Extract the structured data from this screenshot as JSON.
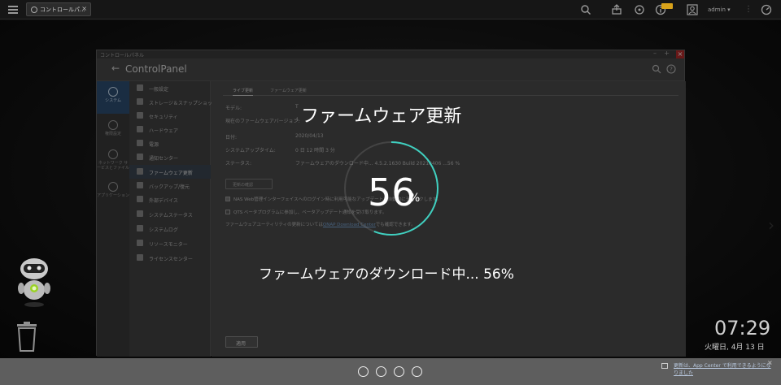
{
  "taskbar": {
    "tab_label": "コントロールパ...",
    "close_glyph": "×",
    "user": "admin ▾"
  },
  "window": {
    "titlebar_title": "コントロールパネル",
    "ctrl_minimize": "–",
    "ctrl_maximize": "+",
    "ctrl_close": "×",
    "app_title": "ControlPanel",
    "back_glyph": "←"
  },
  "categories": [
    {
      "label": "システム"
    },
    {
      "label": "権限設定"
    },
    {
      "label": "ネットワーク サービスとファイル"
    },
    {
      "label": "アプリケーション"
    }
  ],
  "nav": [
    {
      "label": "一般設定"
    },
    {
      "label": "ストレージ＆スナップショット"
    },
    {
      "label": "セキュリティ"
    },
    {
      "label": "ハードウェア"
    },
    {
      "label": "電源"
    },
    {
      "label": "通知センター"
    },
    {
      "label": "ファームウェア更新"
    },
    {
      "label": "バックアップ/復元"
    },
    {
      "label": "外部デバイス"
    },
    {
      "label": "システムステータス"
    },
    {
      "label": "システムログ"
    },
    {
      "label": "リソースモニター"
    },
    {
      "label": "ライセンスセンター"
    }
  ],
  "content": {
    "tabs": [
      "ライブ更新",
      "ファームウェア更新"
    ],
    "rows": [
      {
        "label": "モデル:",
        "value": "T"
      },
      {
        "label": "現在のファームウェアバージョン:",
        "value": "4."
      },
      {
        "label": "日付:",
        "value": "2020/04/13"
      },
      {
        "label": "システムアップタイム:",
        "value": "0 日 12 時間 3 分"
      },
      {
        "label": "ステータス:",
        "value": "ファームウェアのダウンロード中... 4.5.2.1630 Build 20210406 ...56 %"
      }
    ],
    "check_button": "更新の確認",
    "checkbox_1": "NAS Web管理インターフェイスへのログイン時に利用可能なアップデートを自動的にチェックします。",
    "checkbox_2": "QTS ベータプログラムに参加し、ベータアップデート通知を受け取ります。",
    "note_prefix": "ファームウェアユーティリティの更新については",
    "note_link": "QNAP Download Center",
    "note_suffix": "でも確認できます。",
    "apply": "適用"
  },
  "overlay": {
    "title": "ファームウェア更新",
    "percent": "56",
    "percent_unit": "%",
    "status": "ファームウェアのダウンロード中... 56%",
    "progress": 0.56
  },
  "clock": {
    "time": "07:29",
    "date": "火曜日, 4月 13 日"
  },
  "notice": {
    "text": "更新は、App Center で利用できるようになりました"
  },
  "colors": {
    "progress_ring": "#3fd0c0",
    "active_category": "#2d4f73"
  }
}
